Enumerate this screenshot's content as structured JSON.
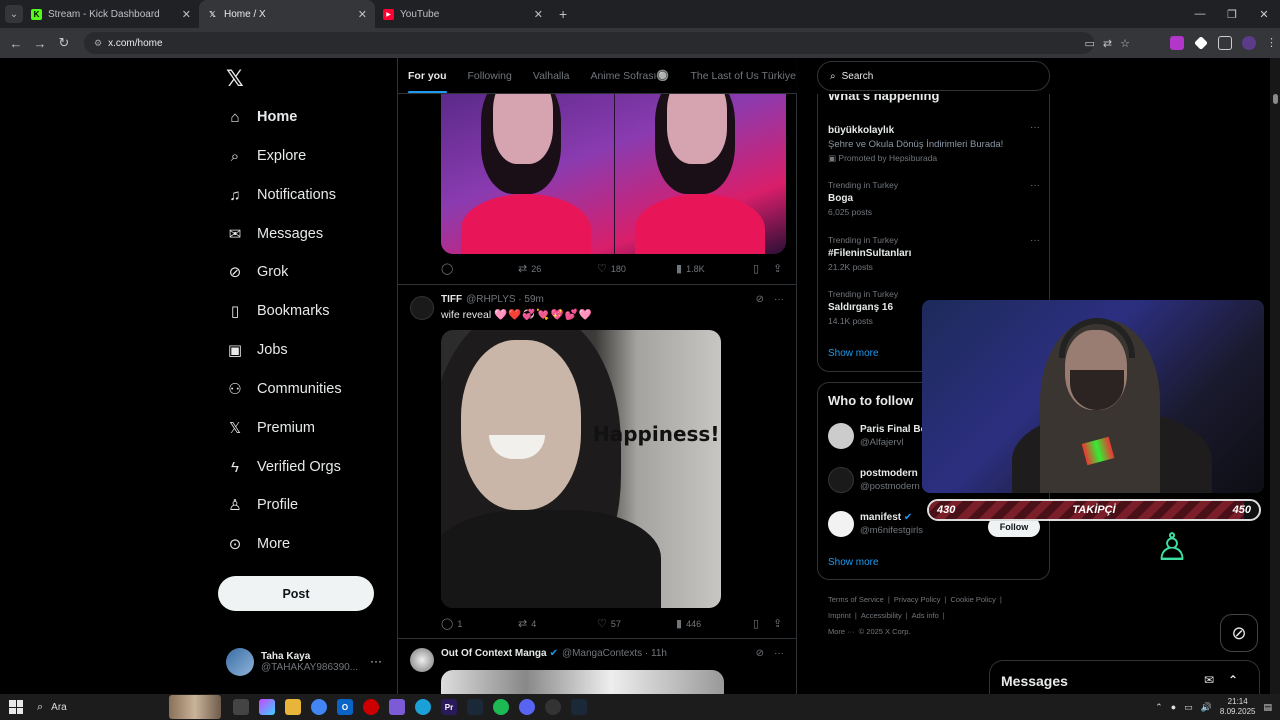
{
  "browser": {
    "tabs": [
      {
        "label": "Stream - Kick Dashboard",
        "fav_color": "#53fc18",
        "fav_glyph": "K"
      },
      {
        "label": "Home / X",
        "fav_color": "#ffffff",
        "fav_glyph": "𝕏"
      },
      {
        "label": "YouTube",
        "fav_color": "#ff0033",
        "fav_glyph": "▶"
      }
    ],
    "new_tab": "+",
    "url": "x.com/home"
  },
  "nav": {
    "logo": "𝕏",
    "items": [
      {
        "label": "Home",
        "icon": "home-icon",
        "glyph": "⌂"
      },
      {
        "label": "Explore",
        "icon": "search-icon",
        "glyph": "⌕"
      },
      {
        "label": "Notifications",
        "icon": "bell-icon",
        "glyph": "♫"
      },
      {
        "label": "Messages",
        "icon": "mail-icon",
        "glyph": "✉"
      },
      {
        "label": "Grok",
        "icon": "grok-icon",
        "glyph": "⊘"
      },
      {
        "label": "Bookmarks",
        "icon": "bookmark-icon",
        "glyph": "▯"
      },
      {
        "label": "Jobs",
        "icon": "briefcase-icon",
        "glyph": "▣"
      },
      {
        "label": "Communities",
        "icon": "people-icon",
        "glyph": "⚇"
      },
      {
        "label": "Premium",
        "icon": "x-icon",
        "glyph": "𝕏"
      },
      {
        "label": "Verified Orgs",
        "icon": "lightning-icon",
        "glyph": "ϟ"
      },
      {
        "label": "Profile",
        "icon": "user-icon",
        "glyph": "♙"
      },
      {
        "label": "More",
        "icon": "more-circle-icon",
        "glyph": "⊙"
      }
    ],
    "post_label": "Post",
    "profile_name": "Taha Kaya",
    "profile_handle": "@TAHAKAY986390...",
    "more_dots": "···"
  },
  "feed": {
    "tabs": [
      "For you",
      "Following",
      "Valhalla",
      "Anime Sofrası🔘",
      "The Last of Us Türkiye"
    ],
    "post1_actions": {
      "replies": "",
      "reposts": "26",
      "likes": "180",
      "views": "1.8K"
    },
    "post2": {
      "name": "TIFF",
      "handle": "@RHPLYS · 59m",
      "text": "wife reveal",
      "hearts": "🩷❤️💞💘💖💕🩷",
      "image_text": "Happiness!",
      "actions": {
        "replies": "1",
        "reposts": "4",
        "likes": "57",
        "views": "446"
      }
    },
    "post3": {
      "name": "Out Of Context Manga",
      "handle": "@MangaContexts · 11h"
    }
  },
  "right": {
    "search_placeholder": "Search",
    "happening_title": "What's happening",
    "trends": [
      {
        "category": "",
        "title": "büyükkolaylık",
        "count": "Şehre ve Okula Dönüş İndirimleri Burada!",
        "promo": "Promoted by Hepsiburada"
      },
      {
        "category": "Trending in Turkey",
        "title": "Boga",
        "count": "6,025 posts"
      },
      {
        "category": "Trending in Turkey",
        "title": "#FileninSultanları",
        "count": "21.2K posts"
      },
      {
        "category": "Trending in Turkey",
        "title": "Saldırganş 16",
        "count": "14.1K posts"
      }
    ],
    "show_more": "Show more",
    "who_title": "Who to follow",
    "follow": [
      {
        "name": "Paris Final Bo",
        "handle": "@Alfajervl",
        "color": "#cccccc"
      },
      {
        "name": "postmodern",
        "handle": "@postmodern",
        "color": "#1a1a1a"
      },
      {
        "name": "manifest",
        "handle": "@m6nifestgirls",
        "color": "#f2f2f2"
      }
    ],
    "follow_label": "Follow",
    "show_more2": "Show more",
    "footer": [
      "Terms of Service",
      "|",
      "Privacy Policy",
      "|",
      "Cookie Policy",
      "|",
      "Imprint",
      "|",
      "Accessibility",
      "|",
      "Ads info",
      "|",
      "More ···",
      "© 2025 X Corp."
    ]
  },
  "overlay": {
    "followers_current": "430",
    "followers_label": "TAKİPÇİ",
    "followers_goal": "450",
    "progress_fraction": 0.955
  },
  "messages_dock": {
    "title": "Messages"
  },
  "taskbar": {
    "search_label": "Ara",
    "time": "21:14",
    "date": "8.09.2025"
  },
  "colors": {
    "accent": "#1d9bf0",
    "background": "#000000"
  }
}
